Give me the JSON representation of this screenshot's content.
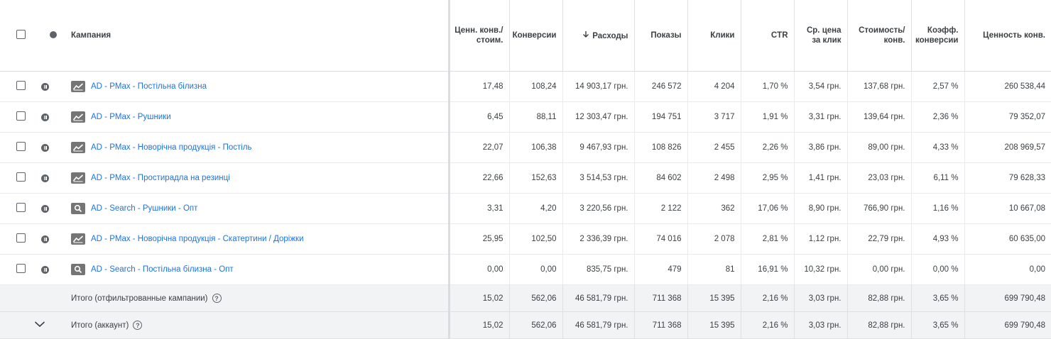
{
  "header": {
    "campaign": "Кампания",
    "value_per_cost_1": "Ценн. конв./",
    "value_per_cost_2": "стоим.",
    "conversions": "Конверсии",
    "cost": "Расходы",
    "impressions": "Показы",
    "clicks": "Клики",
    "ctr": "CTR",
    "avg_cpc_1": "Ср. цена",
    "avg_cpc_2": "за клик",
    "cost_per_conv_1": "Стоимость/",
    "cost_per_conv_2": "конв.",
    "conv_rate_1": "Коэфф.",
    "conv_rate_2": "конверсии",
    "conv_value": "Ценность конв."
  },
  "rows": [
    {
      "type": "pmax",
      "name": "AD - PMax - Постільна білизна",
      "vpc": "17,48",
      "conv": "108,24",
      "cost": "14 903,17 грн.",
      "impr": "246 572",
      "clicks": "4 204",
      "ctr": "1,70 %",
      "cpc": "3,54 грн.",
      "cpconv": "137,68 грн.",
      "cr": "2,57 %",
      "value": "260 538,44"
    },
    {
      "type": "pmax",
      "name": "AD - PMax - Рушники",
      "vpc": "6,45",
      "conv": "88,11",
      "cost": "12 303,47 грн.",
      "impr": "194 751",
      "clicks": "3 717",
      "ctr": "1,91 %",
      "cpc": "3,31 грн.",
      "cpconv": "139,64 грн.",
      "cr": "2,36 %",
      "value": "79 352,07"
    },
    {
      "type": "pmax",
      "name": "AD - PMax - Новорічна продукція - Постіль",
      "vpc": "22,07",
      "conv": "106,38",
      "cost": "9 467,93 грн.",
      "impr": "108 826",
      "clicks": "2 455",
      "ctr": "2,26 %",
      "cpc": "3,86 грн.",
      "cpconv": "89,00 грн.",
      "cr": "4,33 %",
      "value": "208 969,57"
    },
    {
      "type": "pmax",
      "name": "AD - PMax - Простирадла на резинці",
      "vpc": "22,66",
      "conv": "152,63",
      "cost": "3 514,53 грн.",
      "impr": "84 602",
      "clicks": "2 498",
      "ctr": "2,95 %",
      "cpc": "1,41 грн.",
      "cpconv": "23,03 грн.",
      "cr": "6,11 %",
      "value": "79 628,33"
    },
    {
      "type": "search",
      "name": "AD - Search - Рушники - Опт",
      "vpc": "3,31",
      "conv": "4,20",
      "cost": "3 220,56 грн.",
      "impr": "2 122",
      "clicks": "362",
      "ctr": "17,06 %",
      "cpc": "8,90 грн.",
      "cpconv": "766,90 грн.",
      "cr": "1,16 %",
      "value": "10 667,08"
    },
    {
      "type": "pmax",
      "name": "AD - PMax - Новорічна продукція - Скатертини / Доріжки",
      "vpc": "25,95",
      "conv": "102,50",
      "cost": "2 336,39 грн.",
      "impr": "74 016",
      "clicks": "2 078",
      "ctr": "2,81 %",
      "cpc": "1,12 грн.",
      "cpconv": "22,79 грн.",
      "cr": "4,93 %",
      "value": "60 635,00"
    },
    {
      "type": "search",
      "name": "AD - Search - Постільна білизна - Опт",
      "vpc": "0,00",
      "conv": "0,00",
      "cost": "835,75 грн.",
      "impr": "479",
      "clicks": "81",
      "ctr": "16,91 %",
      "cpc": "10,32 грн.",
      "cpconv": "0,00 грн.",
      "cr": "0,00 %",
      "value": "0,00"
    }
  ],
  "totals": [
    {
      "label": "Итого (отфильтрованные кампании)",
      "vpc": "15,02",
      "conv": "562,06",
      "cost": "46 581,79 грн.",
      "impr": "711 368",
      "clicks": "15 395",
      "ctr": "2,16 %",
      "cpc": "3,03 грн.",
      "cpconv": "82,88 грн.",
      "cr": "3,65 %",
      "value": "699 790,48"
    },
    {
      "label": "Итого (аккаунт)",
      "vpc": "15,02",
      "conv": "562,06",
      "cost": "46 581,79 грн.",
      "impr": "711 368",
      "clicks": "15 395",
      "ctr": "2,16 %",
      "cpc": "3,03 грн.",
      "cpconv": "82,88 грн.",
      "cr": "3,65 %",
      "value": "699 790,48"
    }
  ],
  "help_glyph": "?",
  "icons": {
    "pmax": "trending-chart-icon",
    "search": "search-icon",
    "status": "paused-icon",
    "sort": "arrow-down-icon",
    "expand": "chevron-down-icon"
  },
  "colors": {
    "link": "#1a73e8",
    "total_bg": "#f1f3f4",
    "icon_gray": "#757575"
  }
}
